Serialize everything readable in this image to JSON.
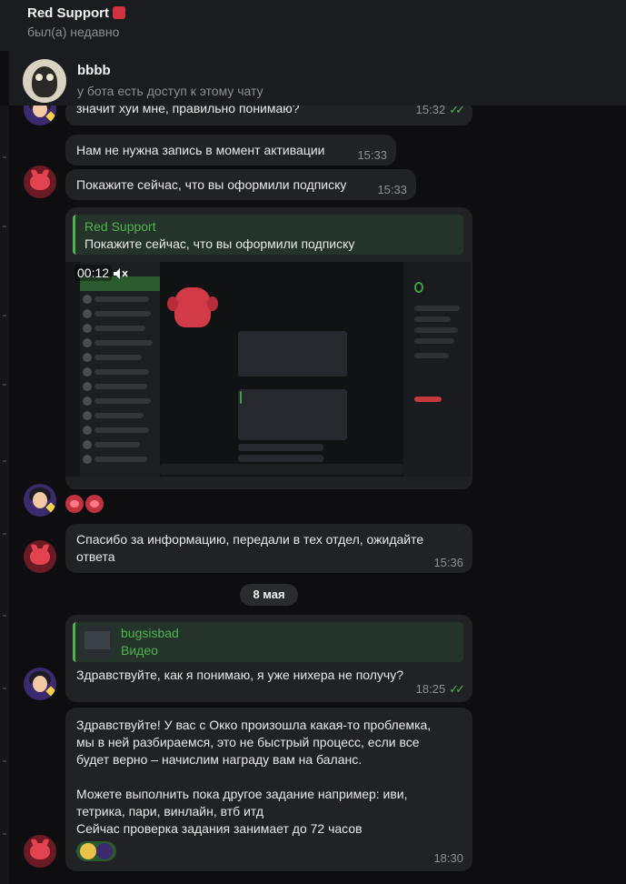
{
  "header": {
    "title": "Red Support",
    "status": "был(а) недавно"
  },
  "pinned": {
    "name": "bbbb",
    "info": "у бота есть доступ к этому чату"
  },
  "messages": [
    {
      "text": "значит хуй мне, правильно понимаю?",
      "time": "15:32"
    },
    {
      "text": "Нам не нужна запись в момент активации",
      "time": "15:33"
    },
    {
      "text": "Покажите сейчас, что вы оформили подписку",
      "time": "15:33"
    },
    {
      "reply_name": "Red Support",
      "reply_text": "Покажите сейчас, что вы оформили подписку",
      "video_time": "00:12"
    },
    {
      "text": "Спасибо за информацию, передали в тех отдел, ожидайте ответа",
      "time": "15:36"
    },
    {
      "reply_name": "bugsisbad",
      "reply_text": "Видео",
      "text": "Здравствуйте, как я понимаю, я уже нихера не получу?",
      "time": "18:25"
    },
    {
      "lines": [
        "Здравствуйте! У вас с Окко произошла какая-то проблемка,",
        "мы в ней разбираемся, это не быстрый процесс, если все",
        "будет верно – начислим награду вам на баланс.",
        "",
        "Можете выполнить пока другое задание например: иви,",
        "тетрика, пари, винлайн, втб итд",
        "Сейчас проверка задания занимает до 72 часов"
      ],
      "time": "18:30"
    }
  ],
  "date_separator": "8 мая",
  "colors": {
    "accent": "#4fb34f",
    "bubble": "#212226",
    "background": "#0e0e10"
  }
}
